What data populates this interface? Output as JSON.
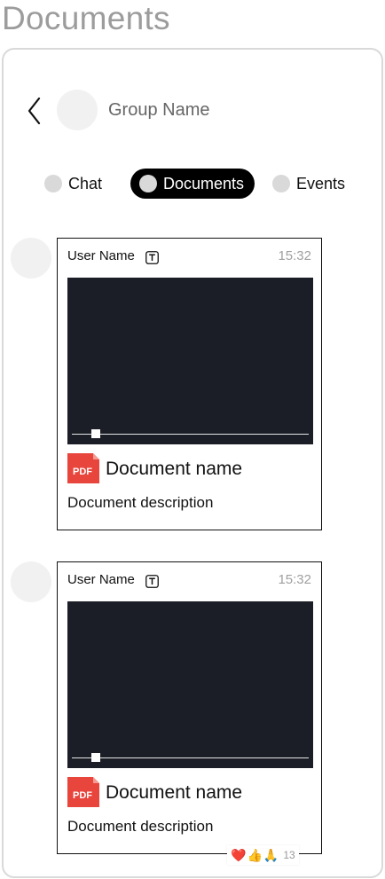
{
  "page": {
    "title": "Documents"
  },
  "header": {
    "group_name": "Group Name"
  },
  "tabs": [
    {
      "label": "Chat",
      "active": false
    },
    {
      "label": "Documents",
      "active": true
    },
    {
      "label": "Events",
      "active": false
    }
  ],
  "messages": [
    {
      "user_name": "User Name",
      "time": "15:32",
      "doc_icon": "PDF",
      "doc_name": "Document name",
      "doc_description": "Document description",
      "preview_progress": 0.1
    },
    {
      "user_name": "User Name",
      "time": "15:32",
      "doc_icon": "PDF",
      "doc_name": "Document name",
      "doc_description": "Document description",
      "preview_progress": 0.1,
      "reactions": {
        "emojis": [
          "❤️",
          "👍",
          "🙏"
        ],
        "count": "13"
      }
    }
  ],
  "colors": {
    "preview_bg": "#1b1e27",
    "pdf_red": "#e8453c",
    "active_tab_bg": "#000000",
    "muted_text": "#a0a0a0"
  },
  "icons": {
    "back": "chevron-left-icon",
    "type": "text-type-icon",
    "pdf": "pdf-file-icon"
  }
}
